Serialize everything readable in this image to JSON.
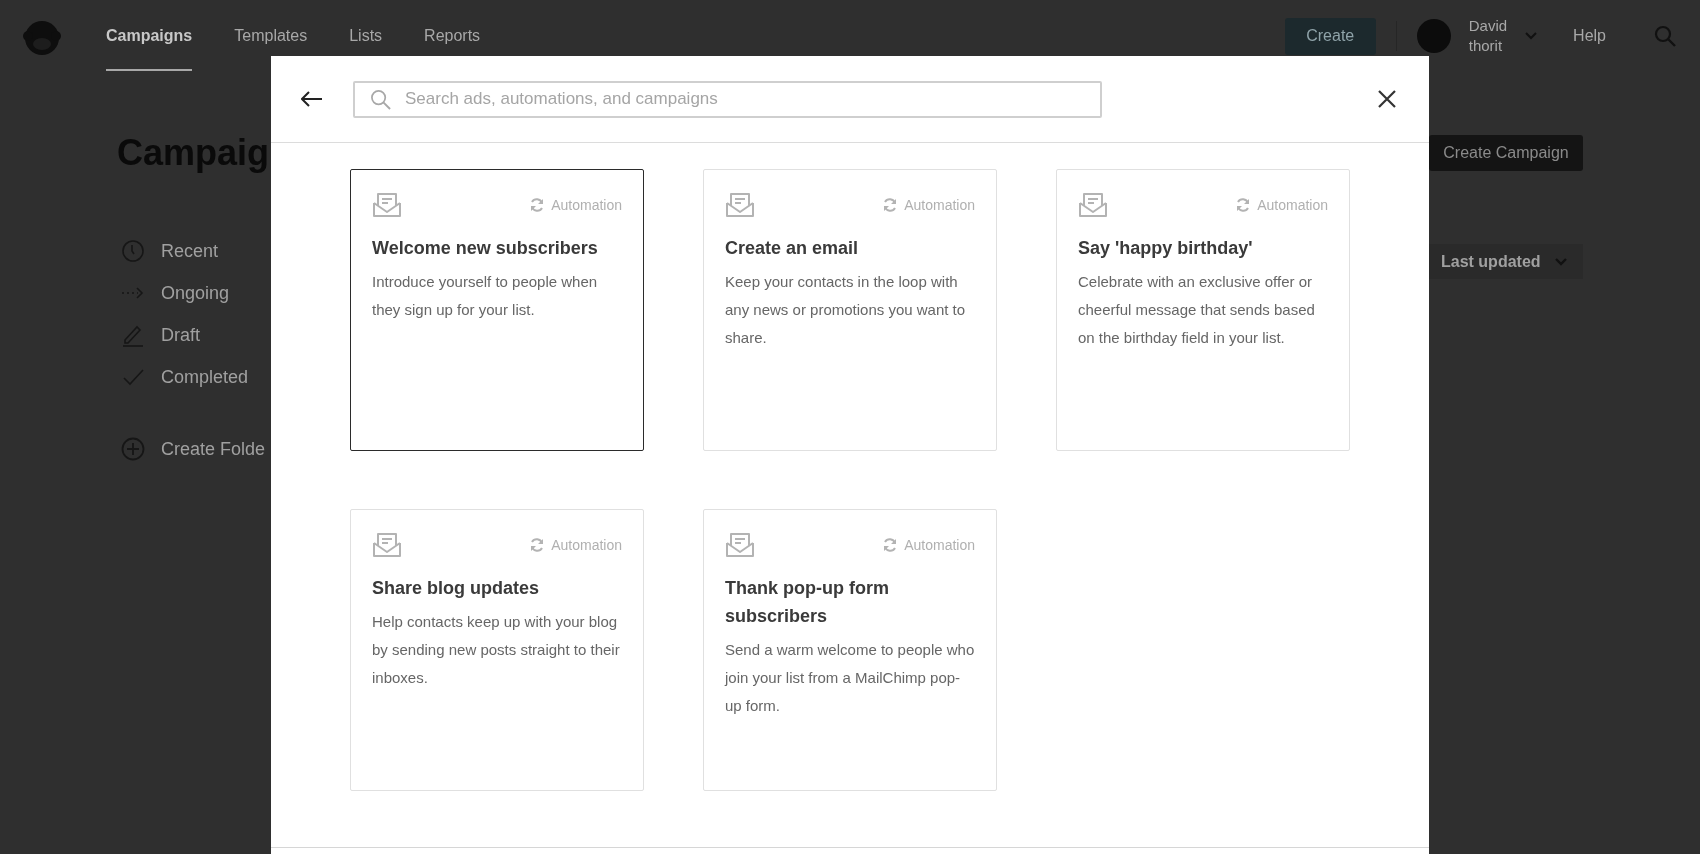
{
  "nav": {
    "tabs": [
      {
        "label": "Campaigns",
        "selected": true
      },
      {
        "label": "Templates",
        "selected": false
      },
      {
        "label": "Lists",
        "selected": false
      },
      {
        "label": "Reports",
        "selected": false
      }
    ],
    "create_button": "Create",
    "user": {
      "first_name": "David",
      "last_name": "thorit"
    },
    "help": "Help"
  },
  "page": {
    "title": "Campaig",
    "create_campaign_button": "Create Campaign",
    "sort_dropdown": "Last updated",
    "sidebar": {
      "items": [
        {
          "kind": "recent",
          "label": "Recent"
        },
        {
          "kind": "ongoing",
          "label": "Ongoing"
        },
        {
          "kind": "draft",
          "label": "Draft"
        },
        {
          "kind": "completed",
          "label": "Completed"
        }
      ],
      "create_folder": "Create Folde"
    }
  },
  "modal": {
    "search": {
      "placeholder": "Search ads, automations, and campaigns"
    },
    "cards": [
      {
        "tag": "Automation",
        "title": "Welcome new subscribers",
        "description": "Introduce yourself to people when they sign up for your list.",
        "selected": true
      },
      {
        "tag": "Automation",
        "title": "Create an email",
        "description": "Keep your contacts in the loop with any news or promotions you want to share.",
        "selected": false
      },
      {
        "tag": "Automation",
        "title": "Say 'happy birthday'",
        "description": "Celebrate with an exclusive offer or cheerful message that sends based on the birthday field in your list.",
        "selected": false
      },
      {
        "tag": "Automation",
        "title": "Share blog updates",
        "description": "Help contacts keep up with your blog by sending new posts straight to their inboxes.",
        "selected": false
      },
      {
        "tag": "Automation",
        "title": "Thank pop-up form subscribers",
        "description": "Send a warm welcome to people who join your list from a MailChimp pop-up form.",
        "selected": false
      }
    ]
  }
}
